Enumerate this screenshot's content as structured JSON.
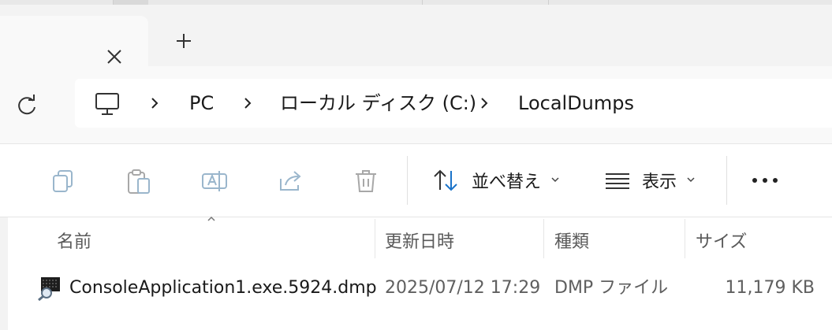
{
  "tabs": {
    "close_icon": "close-icon",
    "new_tab_icon": "plus-icon"
  },
  "address": {
    "refresh_icon": "refresh-icon",
    "pc_icon": "monitor-icon",
    "crumbs": [
      "PC",
      "ローカル ディスク (C:)",
      "LocalDumps"
    ],
    "separator_icon": "chevron-right-icon"
  },
  "toolbar": {
    "sort_label": "並べ替え",
    "view_label": "表示",
    "icons": [
      "copy-icon",
      "paste-icon",
      "rename-icon",
      "share-icon",
      "delete-icon",
      "sort-icon",
      "view-icon",
      "more-icon"
    ]
  },
  "columns": {
    "name": "名前",
    "modified": "更新日時",
    "type": "種類",
    "size": "サイズ"
  },
  "files": [
    {
      "name": "ConsoleApplication1.exe.5924.dmp",
      "modified": "2025/07/12 17:29",
      "type": "DMP ファイル",
      "size": "11,179 KB",
      "icon": "dump-file-icon"
    }
  ]
}
